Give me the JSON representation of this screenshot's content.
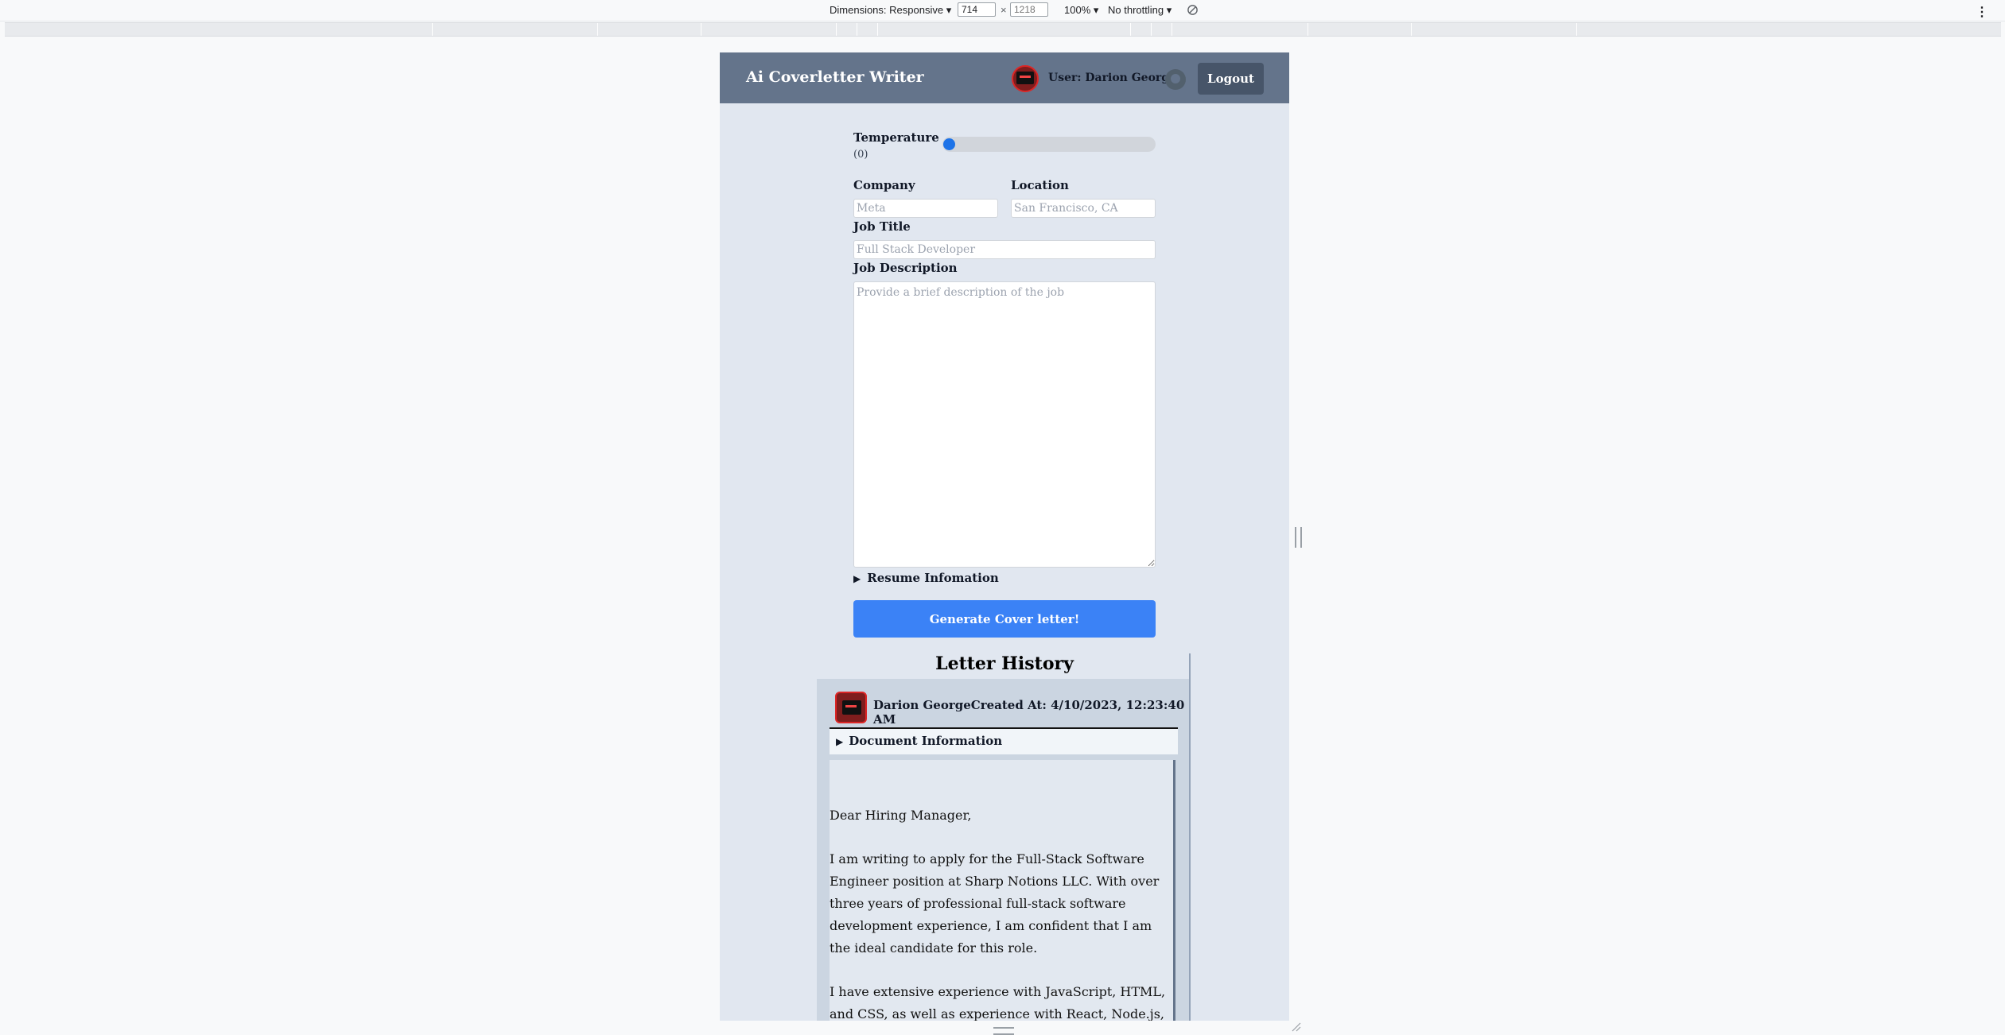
{
  "devtools": {
    "dimensions_label": "Dimensions: Responsive",
    "width_value": "714",
    "height_placeholder": "1218",
    "times": "×",
    "zoom_label": "100%",
    "throttle_label": "No throttling",
    "more_icon": "⋮"
  },
  "header": {
    "title": "Ai Coverletter Writer",
    "user_label": "User: Darion George",
    "logout_label": "Logout"
  },
  "form": {
    "temperature_label": "Temperature",
    "temperature_value": "(0)",
    "temperature_level": 0,
    "company_label": "Company",
    "company_placeholder": "Meta",
    "location_label": "Location",
    "location_placeholder": "San Francisco, CA",
    "job_title_label": "Job Title",
    "job_title_placeholder": "Full Stack Developer",
    "job_description_label": "Job Description",
    "job_description_placeholder": "Provide a brief description of the job",
    "resume_info_label": "Resume Infomation",
    "generate_label": "Generate Cover letter!"
  },
  "history": {
    "title": "Letter History",
    "card": {
      "heading": "Darion GeorgeCreated At: 4/10/2023, 12:23:40 AM",
      "doc_info_label": "Document Information",
      "letter_paragraphs": [
        "Dear Hiring Manager,",
        "I am writing to apply for the Full-Stack Software Engineer position at Sharp Notions LLC. With over three years of professional full-stack software development experience, I am confident that I am the ideal candidate for this role.",
        "I have extensive experience with JavaScript, HTML, and CSS, as well as experience with React, Node.js, and"
      ]
    }
  }
}
